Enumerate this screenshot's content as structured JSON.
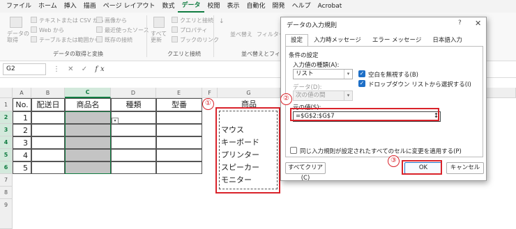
{
  "menu": {
    "items": [
      "ファイル",
      "ホーム",
      "挿入",
      "描画",
      "ページ レイアウト",
      "数式",
      "データ",
      "校閲",
      "表示",
      "自動化",
      "開発",
      "ヘルプ",
      "Acrobat"
    ],
    "active": "データ"
  },
  "ribbon": {
    "get_data": "データの\n取得",
    "from_text_csv": "テキストまたは CSV から",
    "from_web": "Web から",
    "from_table": "テーブルまたは範囲から",
    "from_image": "画像から",
    "recent_sources": "最近使ったソース",
    "existing_connections": "既存の接続",
    "group_get_transform": "データの取得と変換",
    "refresh_all": "すべて\n更新",
    "queries_connections": "クエリと接続",
    "properties": "プロパティ",
    "edit_links": "ブックのリンク",
    "group_queries": "クエリと接続",
    "sort": "並べ替え",
    "filter": "フィルター",
    "group_sort_filter": "並べ替えとフィルター"
  },
  "formula_bar": {
    "name_box": "G2",
    "icons": "⋮  ✕  ✓",
    "fx": "fx",
    "content": ""
  },
  "sheet": {
    "columns": [
      "A",
      "B",
      "C",
      "D",
      "E",
      "F",
      "G"
    ],
    "selected_column": "C",
    "rows": [
      "1",
      "2",
      "3",
      "4",
      "5",
      "6",
      "7",
      "8",
      "9"
    ],
    "selected_rows": [
      "2",
      "3",
      "4",
      "5",
      "6"
    ],
    "headers": {
      "no": "No.",
      "date": "配送日",
      "product": "商品名",
      "type": "種類",
      "model": "型番",
      "list": "商品"
    },
    "numbers": [
      "1",
      "2",
      "3",
      "4",
      "5"
    ],
    "list_items": [
      "マウス",
      "キーボード",
      "プリンター",
      "スピーカー",
      "モニター"
    ]
  },
  "annotations": {
    "one": "①",
    "two": "②",
    "three": "③"
  },
  "dialog": {
    "title": "データの入力規則",
    "help": "?",
    "close": "✕",
    "tabs": [
      "設定",
      "入力時メッセージ",
      "エラー メッセージ",
      "日本語入力"
    ],
    "active_tab": "設定",
    "criteria_label": "条件の設定",
    "allow_label": "入力値の種類(A):",
    "allow_value": "リスト",
    "ignore_blank": "空白を無視する(B)",
    "ignore_blank_checked": true,
    "dropdown": "ドロップダウン リストから選択する(I)",
    "dropdown_checked": true,
    "data_label": "データ(D):",
    "data_value": "次の値の間",
    "source_label": "元の値(S):",
    "source_value": "=$G$2:$G$7",
    "apply_all": "同じ入力規則が設定されたすべてのセルに変更を適用する(P)",
    "apply_all_checked": false,
    "clear_all": "すべてクリア(C)",
    "ok": "OK",
    "cancel": "キャンセル"
  }
}
